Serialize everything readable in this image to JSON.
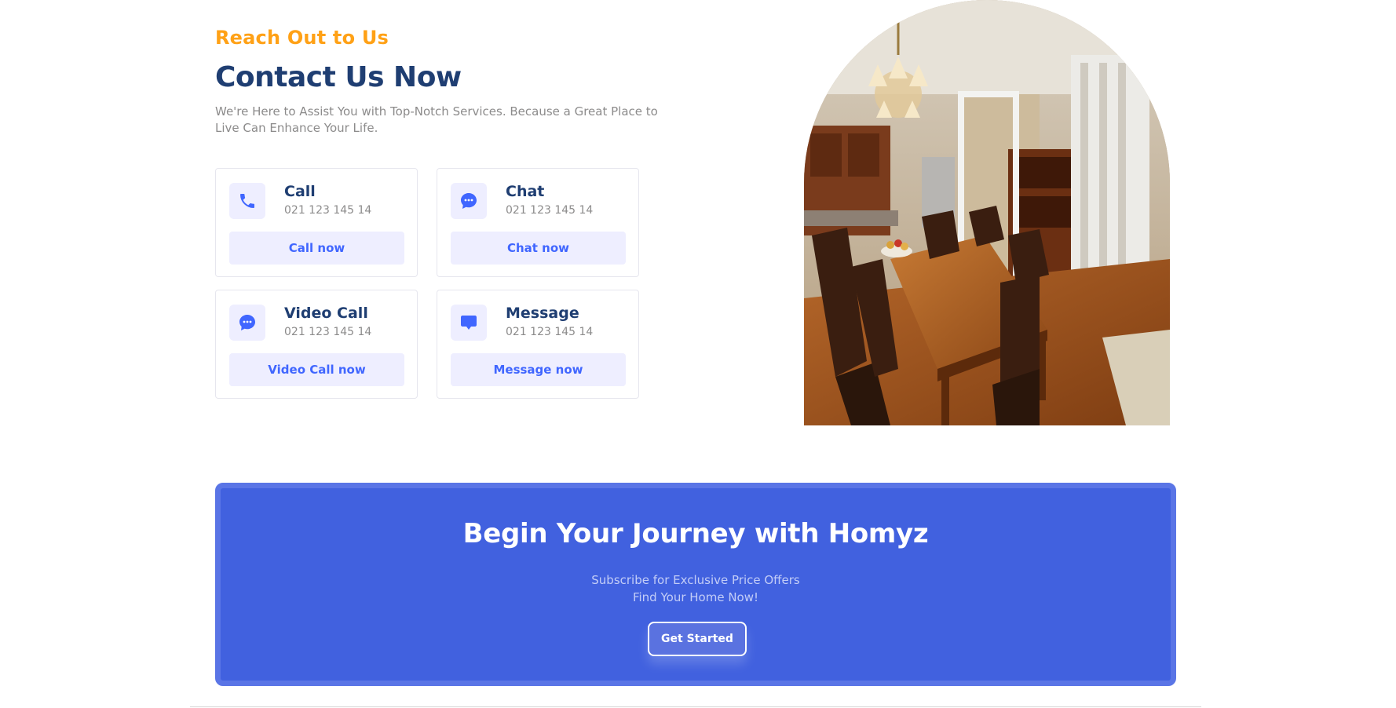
{
  "contact": {
    "eyebrow": "Reach Out to Us",
    "title": "Contact Us Now",
    "description": "We're Here to Assist You with Top-Notch Services. Because a Great Place to Live Can Enhance Your Life.",
    "cards": [
      {
        "title": "Call",
        "detail": "021 123 145 14",
        "button": "Call now",
        "icon": "phone-icon"
      },
      {
        "title": "Chat",
        "detail": "021 123 145 14",
        "button": "Chat now",
        "icon": "chat-bubble-icon"
      },
      {
        "title": "Video Call",
        "detail": "021 123 145 14",
        "button": "Video Call now",
        "icon": "chat-bubble-icon"
      },
      {
        "title": "Message",
        "detail": "021 123 145 14",
        "button": "Message now",
        "icon": "message-icon"
      }
    ]
  },
  "image": {
    "description_icon": "dining-room-photo"
  },
  "banner": {
    "title": "Begin Your Journey with Homyz",
    "line1": "Subscribe for Exclusive Price Offers",
    "line2": "Find Your Home Now!",
    "button": "Get Started"
  },
  "colors": {
    "accent_orange": "#ffa116",
    "navy": "#1f3e72",
    "primary_blue": "#4066ff",
    "banner_blue": "#4161df",
    "soft_lavender": "#eeeeff"
  }
}
